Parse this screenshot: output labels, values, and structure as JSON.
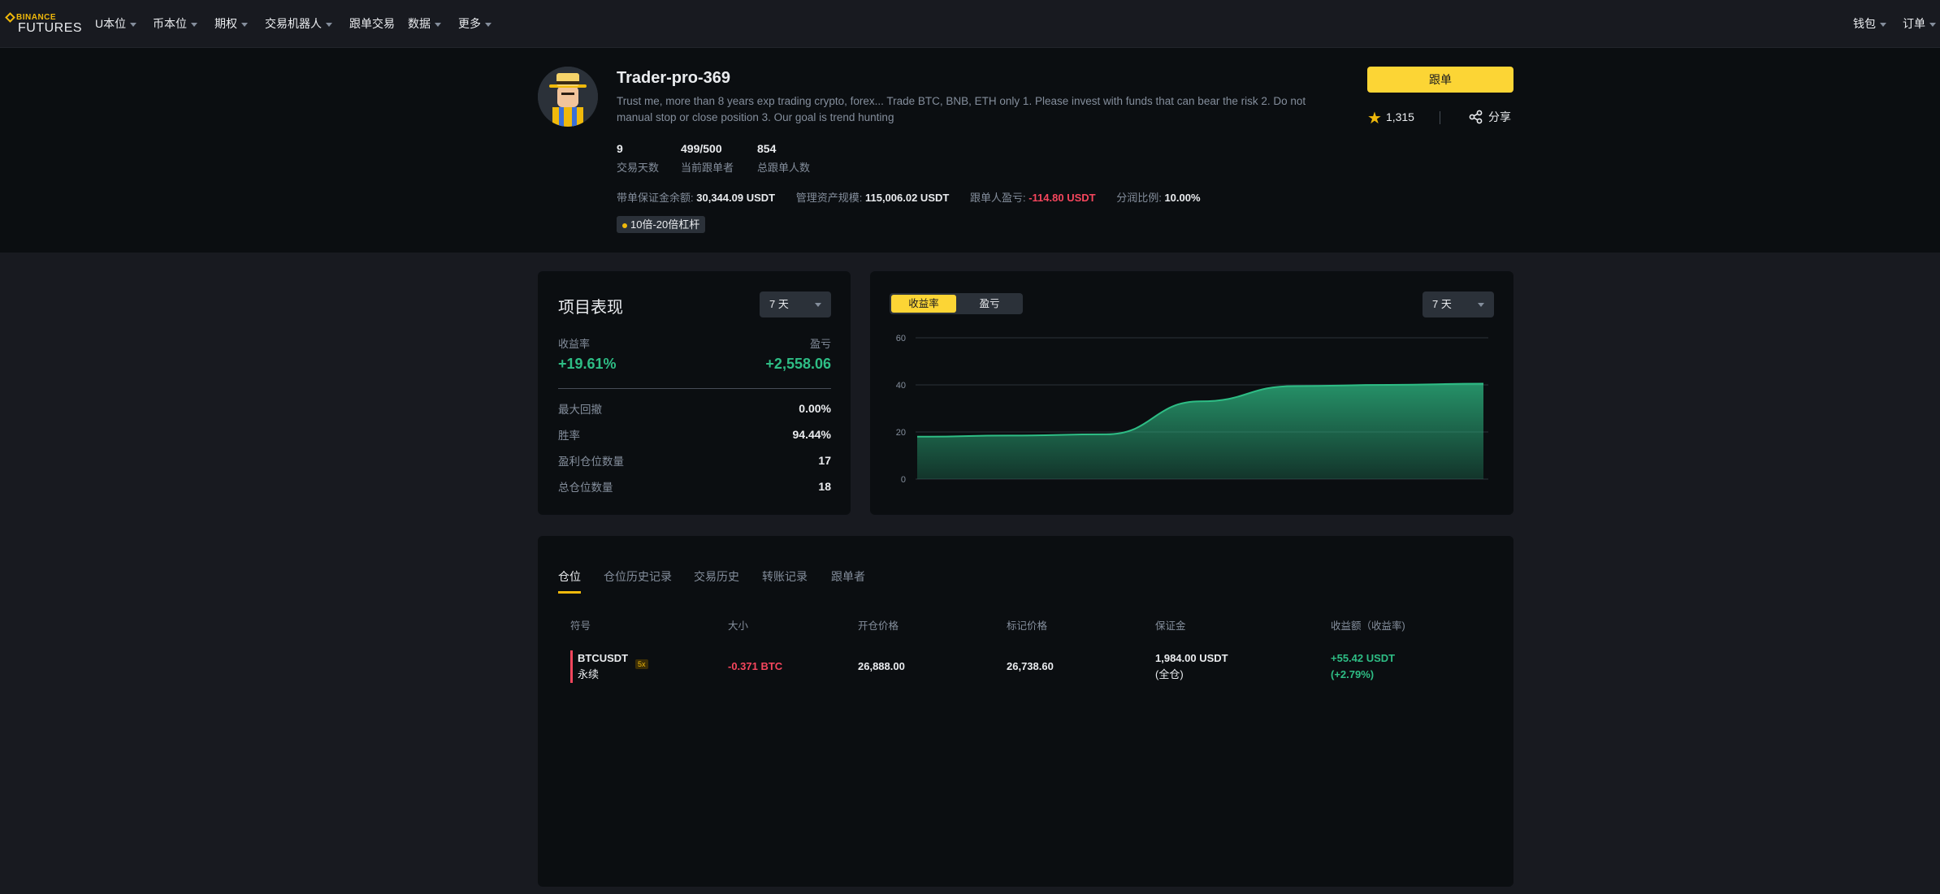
{
  "nav": {
    "logo_top": "BINANCE",
    "logo_bottom": "FUTURES",
    "items": [
      {
        "label": "U本位",
        "dropdown": true
      },
      {
        "label": "币本位",
        "dropdown": true
      },
      {
        "label": "期权",
        "dropdown": true
      },
      {
        "label": "交易机器人",
        "dropdown": true
      },
      {
        "label": "跟单交易",
        "dropdown": false
      },
      {
        "label": "数据",
        "dropdown": true
      },
      {
        "label": "更多",
        "dropdown": true
      }
    ],
    "right": [
      {
        "label": "钱包"
      },
      {
        "label": "订单"
      }
    ]
  },
  "profile": {
    "nickname": "Trader-pro-369",
    "bio": "Trust me, more than 8 years exp trading crypto, forex... Trade BTC, BNB, ETH only 1. Please invest with funds that can bear the risk 2. Do not manual stop or close position 3. Our goal is trend hunting",
    "stats": [
      {
        "value": "9",
        "label": "交易天数"
      },
      {
        "value": "499/500",
        "label": "当前跟单者"
      },
      {
        "value": "854",
        "label": "总跟单人数"
      }
    ],
    "metrics": [
      {
        "label": "带单保证金余额:",
        "value": "30,344.09 USDT"
      },
      {
        "label": "管理资产规模:",
        "value": "115,006.02 USDT"
      },
      {
        "label": "跟单人盈亏:",
        "value": "-114.80 USDT"
      },
      {
        "label": "分润比例:",
        "value": "10.00%"
      }
    ],
    "tag": "10倍-20倍杠杆",
    "copy_button": "跟单",
    "favorites": "1,315",
    "share": "分享"
  },
  "performance": {
    "title": "项目表现",
    "period": "7 天",
    "roi_label": "收益率",
    "roi_value": "+19.61%",
    "pnl_label": "盈亏",
    "pnl_value": "+2,558.06",
    "rows": [
      {
        "label": "最大回撤",
        "value": "0.00%"
      },
      {
        "label": "胜率",
        "value": "94.44%"
      },
      {
        "label": "盈利仓位数量",
        "value": "17"
      },
      {
        "label": "总仓位数量",
        "value": "18"
      }
    ]
  },
  "chart_panel": {
    "toggle_on": "收益率",
    "toggle_off": "盈亏",
    "period": "7 天"
  },
  "chart_data": {
    "type": "area",
    "title": "",
    "xlabel": "",
    "ylabel": "",
    "ylim": [
      0,
      60
    ],
    "yticks": [
      0,
      20,
      40,
      60
    ],
    "grid": true,
    "x": [
      0,
      1,
      2,
      3,
      4,
      5,
      6
    ],
    "series": [
      {
        "values": [
          18,
          18.5,
          19,
          33,
          39.5,
          40,
          40.5
        ]
      }
    ],
    "color": "#2ebd85"
  },
  "positions": {
    "tabs": [
      "仓位",
      "仓位历史记录",
      "交易历史",
      "转账记录",
      "跟单者"
    ],
    "active_tab": 0,
    "columns": [
      "符号",
      "大小",
      "开仓价格",
      "标记价格",
      "保证金",
      "收益额（收益率)"
    ],
    "rows": [
      {
        "symbol": "BTCUSDT",
        "contract": "永续",
        "leverage": "5x",
        "size": "-0.371 BTC",
        "entry_price": "26,888.00",
        "mark_price": "26,738.60",
        "margin": "1,984.00 USDT",
        "margin_mode": "(全仓)",
        "pnl": "+55.42 USDT",
        "pnl_pct": "(+2.79%)"
      }
    ]
  }
}
